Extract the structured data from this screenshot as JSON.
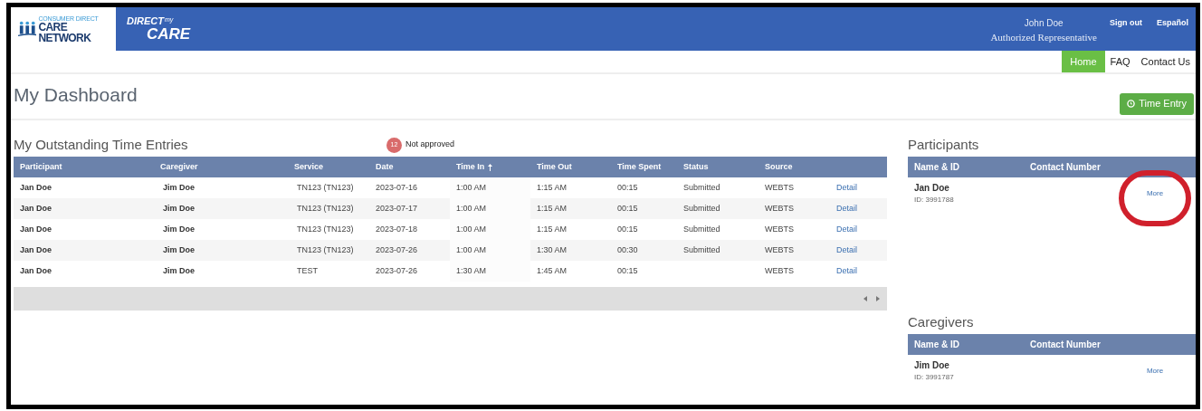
{
  "header": {
    "logo_primary": {
      "top": "CONSUMER DIRECT",
      "bottom": "CARE NETWORK"
    },
    "logo_secondary": {
      "top": "DIRECT",
      "small": "my",
      "bottom": "CARE"
    },
    "user": {
      "name": "John Doe",
      "role": "Authorized Representative"
    },
    "links": [
      "Sign out",
      "Español"
    ]
  },
  "nav": [
    {
      "label": "Home",
      "selected": true
    },
    {
      "label": "FAQ",
      "selected": false
    },
    {
      "label": "Contact Us",
      "selected": false
    }
  ],
  "page_title": "My Dashboard",
  "time_entry_button": "Time Entry",
  "outstanding": {
    "title": "My Outstanding Time Entries",
    "badge": {
      "count": "12",
      "label": "Not approved"
    },
    "columns": [
      {
        "label": "Participant",
        "sorted": false
      },
      {
        "label": "Caregiver",
        "sorted": false
      },
      {
        "label": "Service",
        "sorted": false
      },
      {
        "label": "Date",
        "sorted": false
      },
      {
        "label": "Time In",
        "sorted": true
      },
      {
        "label": "Time Out",
        "sorted": false
      },
      {
        "label": "Time Spent",
        "sorted": false
      },
      {
        "label": "Status",
        "sorted": false
      },
      {
        "label": "Source",
        "sorted": false
      }
    ],
    "rows": [
      {
        "participant": "Jan Doe",
        "caregiver": "Jim Doe",
        "service": "TN123 (TN123)",
        "date": "2023-07-16",
        "time_in": "1:00 AM",
        "time_out": "1:15 AM",
        "time_spent": "00:15",
        "status": "Submitted",
        "source": "WEBTS",
        "action": "Detail"
      },
      {
        "participant": "Jan Doe",
        "caregiver": "Jim Doe",
        "service": "TN123 (TN123)",
        "date": "2023-07-17",
        "time_in": "1:00 AM",
        "time_out": "1:15 AM",
        "time_spent": "00:15",
        "status": "Submitted",
        "source": "WEBTS",
        "action": "Detail"
      },
      {
        "participant": "Jan Doe",
        "caregiver": "Jim Doe",
        "service": "TN123 (TN123)",
        "date": "2023-07-18",
        "time_in": "1:00 AM",
        "time_out": "1:15 AM",
        "time_spent": "00:15",
        "status": "Submitted",
        "source": "WEBTS",
        "action": "Detail"
      },
      {
        "participant": "Jan Doe",
        "caregiver": "Jim Doe",
        "service": "TN123 (TN123)",
        "date": "2023-07-26",
        "time_in": "1:00 AM",
        "time_out": "1:30 AM",
        "time_spent": "00:30",
        "status": "Submitted",
        "source": "WEBTS",
        "action": "Detail"
      },
      {
        "participant": "Jan Doe",
        "caregiver": "Jim Doe",
        "service": "TEST",
        "date": "2023-07-26",
        "time_in": "1:30 AM",
        "time_out": "1:45 AM",
        "time_spent": "00:15",
        "source": "WEBTS",
        "action": "Detail"
      }
    ]
  },
  "participants": {
    "title": "Participants",
    "columns": [
      "Name & ID",
      "Contact Number"
    ],
    "rows": [
      {
        "name": "Jan Doe",
        "id": "ID: 3991788",
        "action": "More",
        "circled": true
      }
    ]
  },
  "caregivers": {
    "title": "Caregivers",
    "columns": [
      "Name & ID",
      "Contact Number"
    ],
    "rows": [
      {
        "name": "Jim Doe",
        "id": "ID: 3991787",
        "action": "More",
        "circled": false
      }
    ]
  }
}
